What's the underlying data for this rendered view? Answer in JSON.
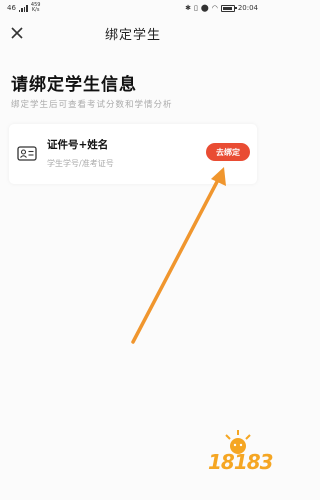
{
  "status_bar": {
    "carrier_left": "46",
    "network_speed": "459",
    "network_unit": "K/s",
    "time": "20:04"
  },
  "nav": {
    "title": "绑定学生",
    "close_icon": "close-icon"
  },
  "heading": "请绑定学生信息",
  "subheading": "绑定学生后可查看考试分数和学情分析",
  "card": {
    "icon": "id-card-icon",
    "title": "证件号+姓名",
    "subtitle": "学生学号/准考证号",
    "button_label": "去绑定"
  },
  "watermark": {
    "text": "18183"
  },
  "colors": {
    "accent": "#e94c33",
    "arrow": "#f0962e",
    "background": "#fbfbfb"
  }
}
